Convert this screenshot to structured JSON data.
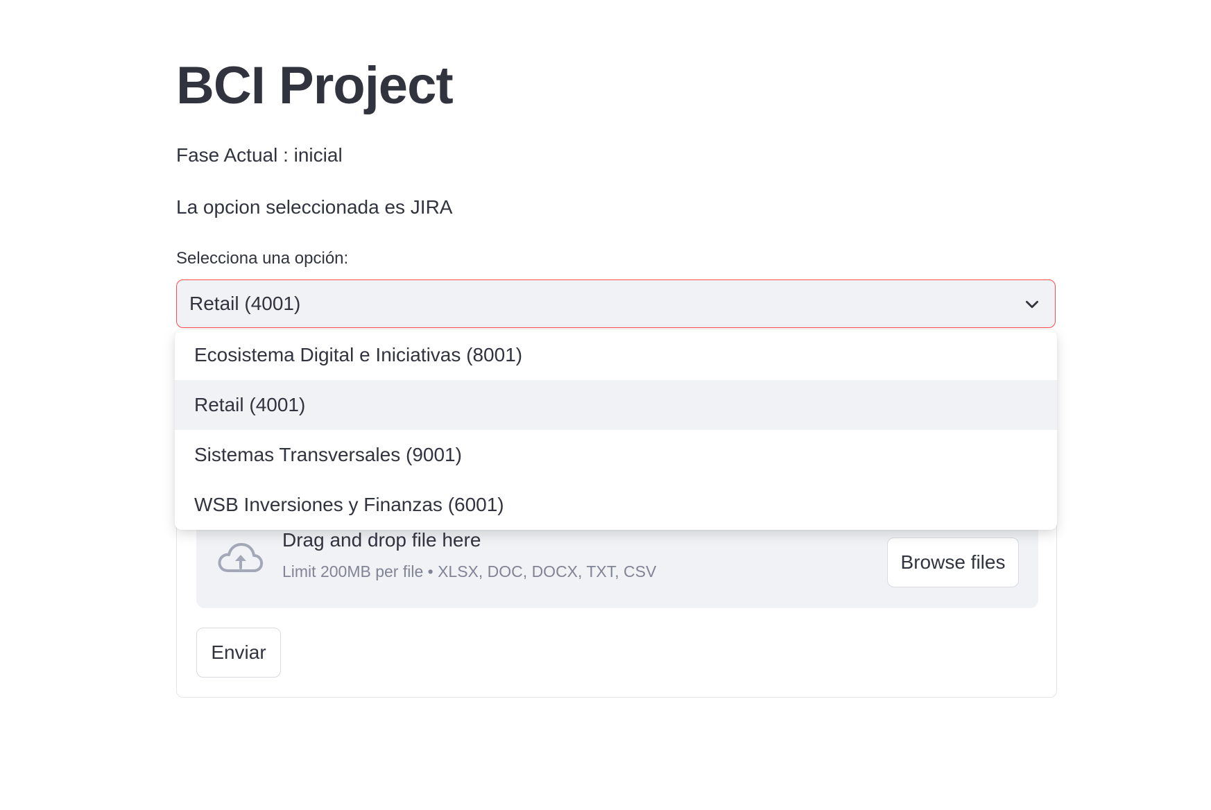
{
  "page": {
    "title": "BCI Project",
    "fase_text": "Fase Actual : inicial",
    "opcion_text": "La opcion seleccionada es JIRA"
  },
  "select": {
    "label": "Selecciona una opción:",
    "value": "Retail (4001)",
    "icon": "chevron-down-icon",
    "border_color": "#ff4b4b",
    "options": [
      "Ecosistema Digital e Iniciativas (8001)",
      "Retail (4001)",
      "Sistemas Transversales (9001)",
      "WSB Inversiones y Finanzas (6001)"
    ],
    "highlighted_option": "Retail (4001)"
  },
  "uploader": {
    "icon": "cloud-upload-icon",
    "title": "Drag and drop file here",
    "limit": "Limit 200MB per file • XLSX, DOC, DOCX, TXT, CSV",
    "browse_label": "Browse files"
  },
  "form": {
    "submit_label": "Enviar"
  },
  "colors": {
    "text": "#31333f",
    "muted": "#808495",
    "input_bg": "#f0f2f6",
    "accent": "#ff4b4b"
  }
}
